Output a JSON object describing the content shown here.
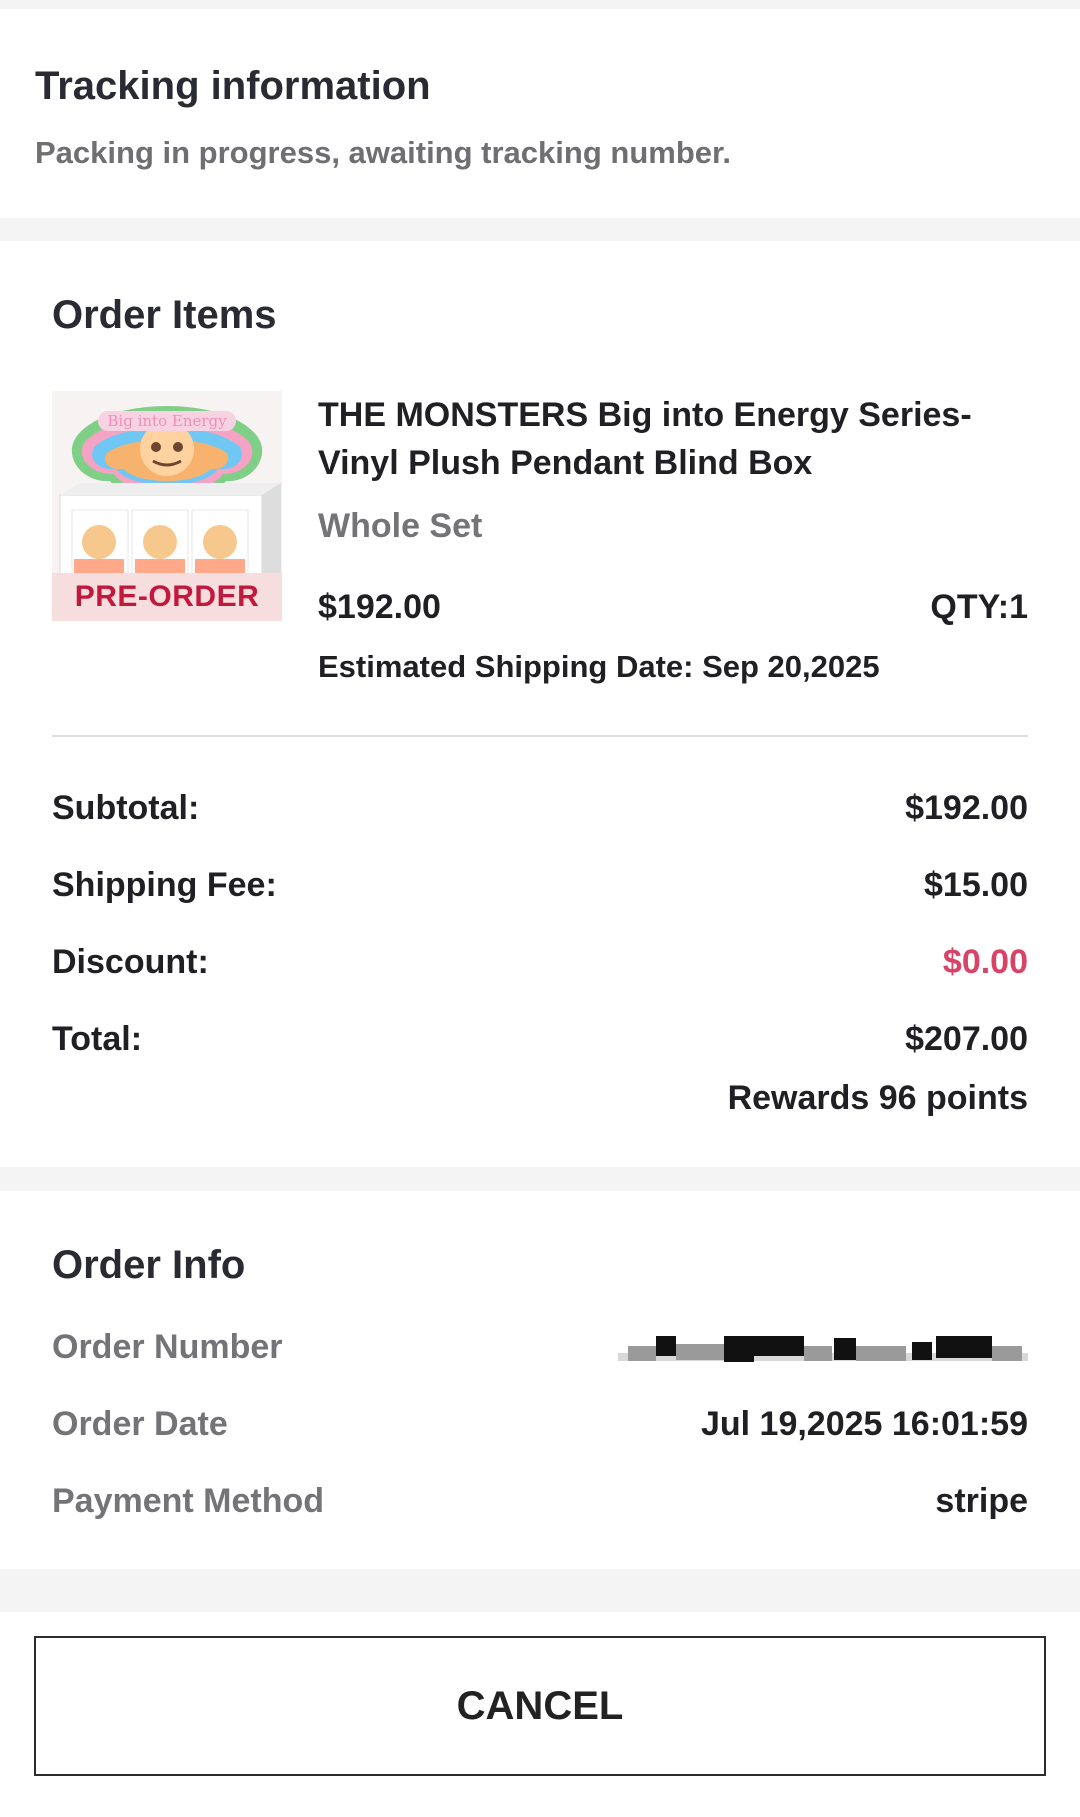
{
  "tracking": {
    "title": "Tracking information",
    "status": "Packing in progress, awaiting tracking number."
  },
  "order_items": {
    "title": "Order Items",
    "items": [
      {
        "name": "THE MONSTERS Big into Energy Series-Vinyl Plush Pendant Blind Box",
        "variant": "Whole Set",
        "price": "$192.00",
        "qty": "QTY:1",
        "estimated_shipping": "Estimated Shipping Date: Sep 20,2025",
        "badge": "PRE-ORDER",
        "image_text": "Big into Energy",
        "image_icon": "blind-box-product-image"
      }
    ],
    "summary": {
      "subtotal_label": "Subtotal:",
      "subtotal_value": "$192.00",
      "shipping_label": "Shipping Fee:",
      "shipping_value": "$15.00",
      "discount_label": "Discount:",
      "discount_value": "$0.00",
      "total_label": "Total:",
      "total_value": "$207.00",
      "rewards": "Rewards 96 points"
    }
  },
  "order_info": {
    "title": "Order Info",
    "order_number_label": "Order Number",
    "order_date_label": "Order Date",
    "order_date_value": "Jul 19,2025 16:01:59",
    "payment_method_label": "Payment Method",
    "payment_method_value": "stripe"
  },
  "actions": {
    "cancel_label": "CANCEL"
  },
  "colors": {
    "background": "#f4f4f4",
    "card": "#ffffff",
    "discount": "#d84467",
    "preorder_text": "#c2183b",
    "preorder_background": "#f7dede",
    "muted_text": "#737378",
    "primary_text": "#1f1f24"
  }
}
